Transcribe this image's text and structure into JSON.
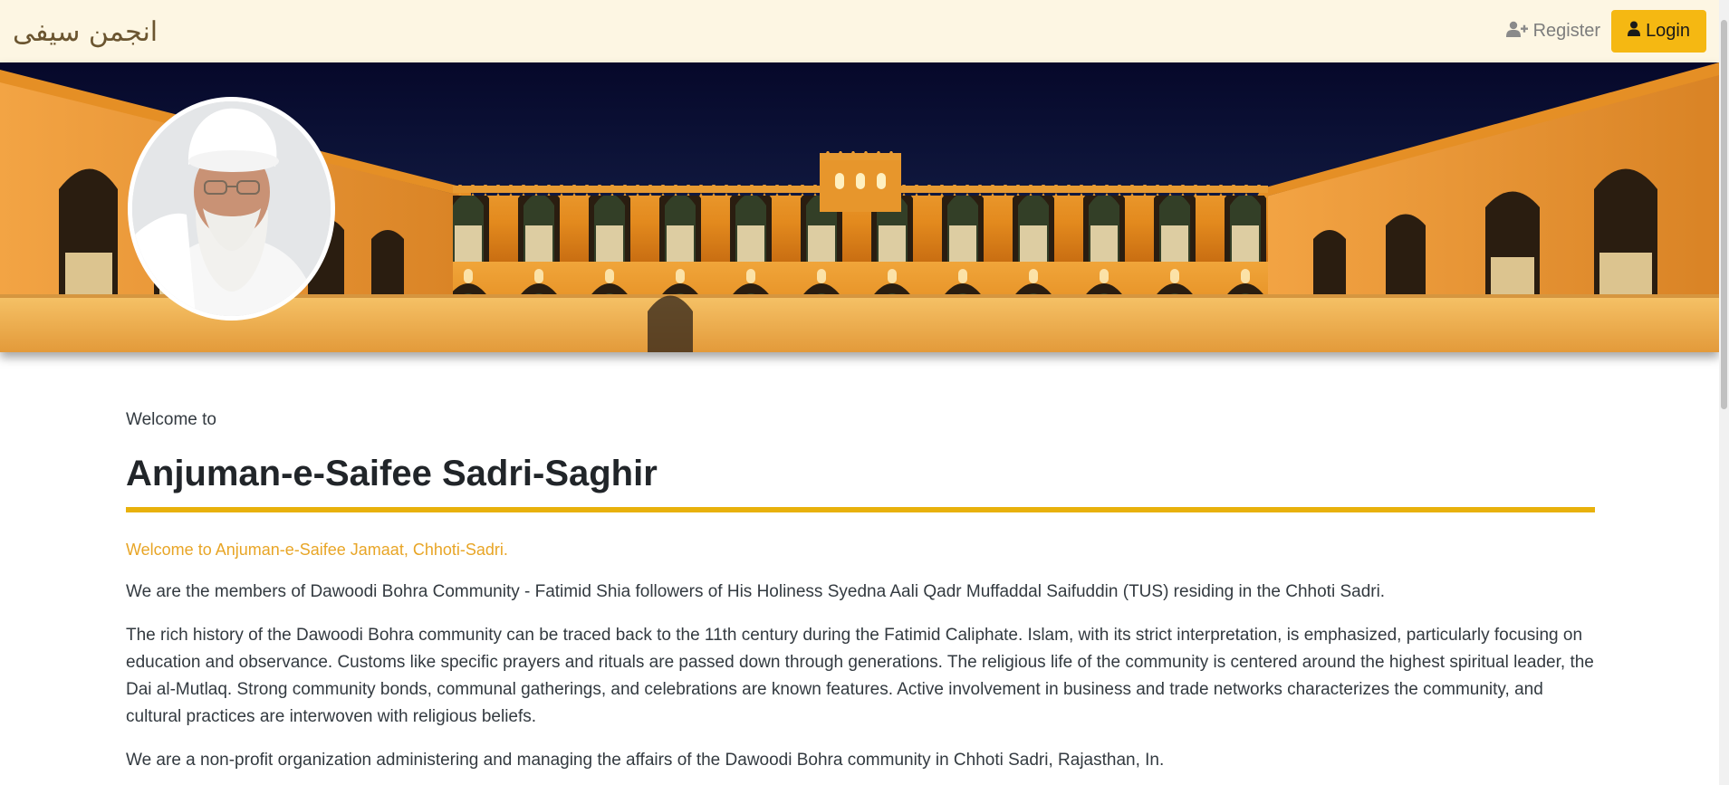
{
  "navbar": {
    "logo_text": "انجمن سیفی",
    "register_label": "Register",
    "register_icon": "user-plus-icon",
    "login_label": "Login",
    "login_icon": "user-icon"
  },
  "banner": {
    "image": "mosque-courtyard-night",
    "profile_photo": "portrait-of-spiritual-leader"
  },
  "content": {
    "welcome_to": "Welcome to",
    "title": "Anjuman-e-Saifee Sadri-Saghir",
    "tagline": "Welcome to Anjuman-e-Saifee Jamaat, Chhoti-Sadri.",
    "paragraphs": [
      "We are the members of Dawoodi Bohra Community - Fatimid Shia followers of His Holiness Syedna Aali Qadr Muffaddal Saifuddin (TUS) residing in the Chhoti Sadri.",
      "The rich history of the Dawoodi Bohra community can be traced back to the 11th century during the Fatimid Caliphate. Islam, with its strict interpretation, is emphasized, particularly focusing on education and observance. Customs like specific prayers and rituals are passed down through generations. The religious life of the community is centered around the highest spiritual leader, the Dai al-Mutlaq. Strong community bonds, communal gatherings, and celebrations are known features. Active involvement in business and trade networks characterizes the community, and cultural practices are interwoven with religious beliefs.",
      "We are a non-profit organization administering and managing the affairs of the Dawoodi Bohra community in Chhoti Sadri, Rajasthan, In."
    ]
  },
  "colors": {
    "navbar_bg": "#fdf6e3",
    "accent": "#f5b812",
    "title_rule": "#e8b10c",
    "tagline": "#e8a526",
    "banner_sky": "#0b1030"
  }
}
